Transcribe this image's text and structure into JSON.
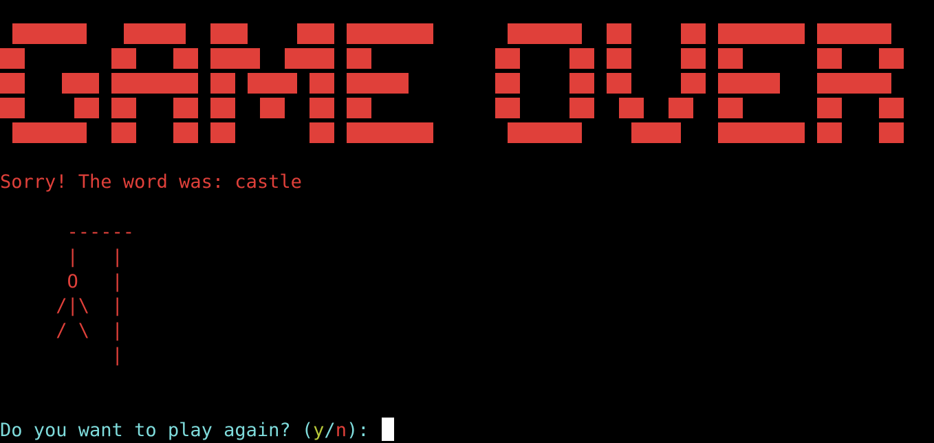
{
  "colors": {
    "background": "#000000",
    "red": "#e0403a",
    "cyan": "#7fdcdc",
    "yellow_green": "#b8c93a",
    "cursor": "#ffffff"
  },
  "banner": {
    "text": "GAME OVER"
  },
  "message": {
    "sorry": "Sorry! The word was: castle"
  },
  "hangman": {
    "art": "      ------\n      |   |\n      O   |\n     /|\\  |\n     / \\  |\n          |"
  },
  "prompt": {
    "text": "Do you want to play again? (",
    "yes_option": "y",
    "separator": "/",
    "no_option": "n",
    "suffix": "): "
  }
}
